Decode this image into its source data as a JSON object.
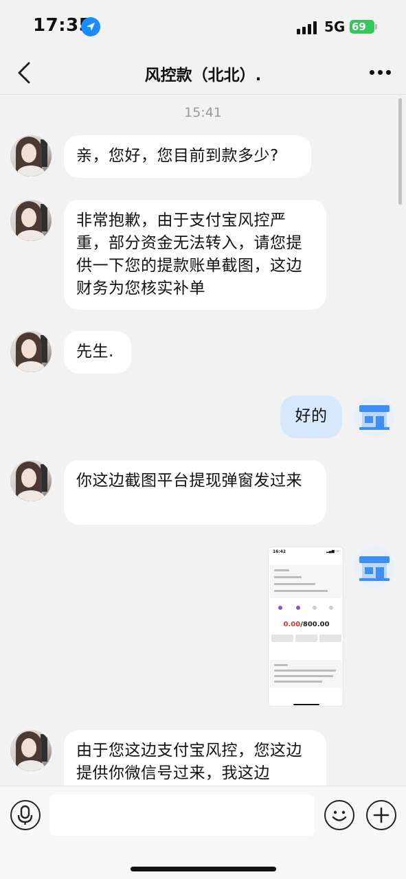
{
  "status_bar": {
    "time": "17:35",
    "network": "5G",
    "battery": "69"
  },
  "nav": {
    "title": "风控款（北北）."
  },
  "chat": {
    "timestamp": "15:41",
    "messages": [
      {
        "from": "them",
        "text": "亲，您好，您目前到款多少?"
      },
      {
        "from": "them",
        "text": "非常抱歉，由于支付宝风控严重，部分资金无法转入，请您提供一下您的提款账单截图，这边财务为您核实补单"
      },
      {
        "from": "them",
        "text": "先生."
      },
      {
        "from": "me",
        "text": "好的"
      },
      {
        "from": "them",
        "text": "你这边截图平台提现弹窗发过来"
      },
      {
        "from": "me",
        "type": "image",
        "screenshot": {
          "time": "16:42",
          "amount_done": "0.00",
          "amount_total": "/800.00"
        }
      },
      {
        "from": "them",
        "text": "由于您这边支付宝风控，您这边提供你微信号过来，我这边"
      }
    ]
  },
  "icons": {
    "back": "chevron-left-icon",
    "more": "more-dots-icon",
    "location": "location-arrow-icon",
    "mic": "microphone-icon",
    "emoji": "emoji-icon",
    "plus": "plus-icon",
    "store": "store-icon"
  },
  "colors": {
    "outgoing_bubble": "#d7e8fd",
    "incoming_bubble": "#ffffff",
    "battery": "#34c759",
    "location": "#1a8cff"
  }
}
